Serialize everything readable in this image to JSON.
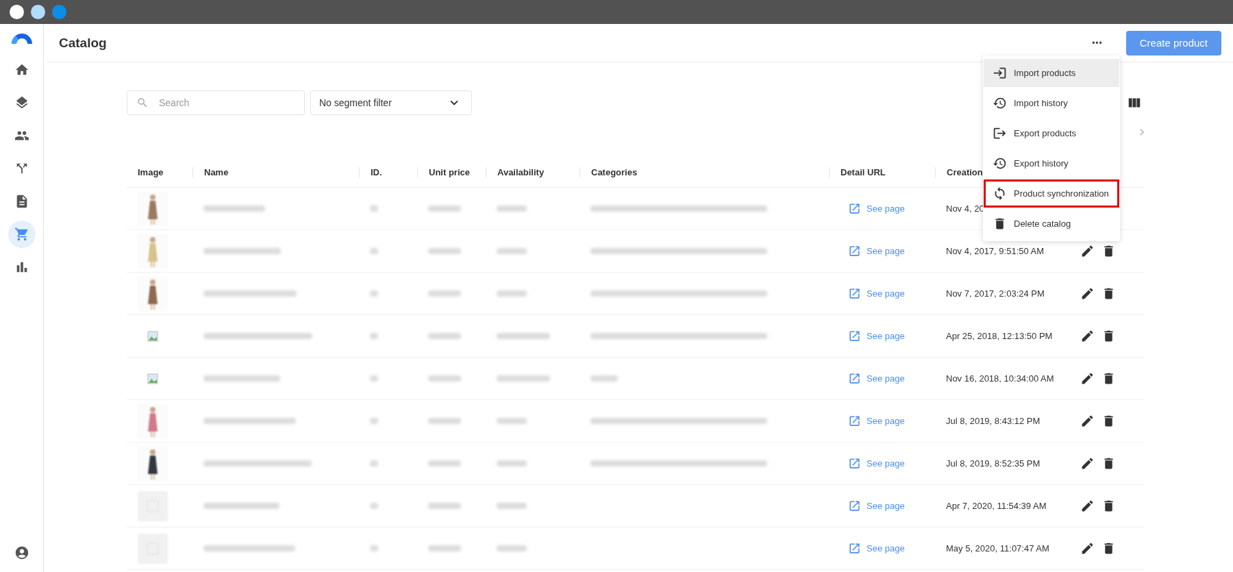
{
  "window": {
    "dots": [
      {
        "color": "#ffffff"
      },
      {
        "color": "#b3dcfb"
      },
      {
        "color": "#0a8ee8"
      }
    ]
  },
  "sidebar": {
    "items": [
      {
        "kind": "home",
        "selected": false
      },
      {
        "kind": "layers",
        "selected": false
      },
      {
        "kind": "people",
        "selected": false
      },
      {
        "kind": "branch",
        "selected": false
      },
      {
        "kind": "document",
        "selected": false
      },
      {
        "kind": "cart",
        "selected": true
      },
      {
        "kind": "chart",
        "selected": false
      }
    ]
  },
  "header": {
    "title": "Catalog",
    "more": "•••",
    "create_button": "Create product"
  },
  "toolbar": {
    "search": {
      "placeholder": "Search"
    },
    "segment_filter": {
      "value": "No segment filter"
    }
  },
  "table": {
    "columns": [
      "Image",
      "Name",
      "ID.",
      "Unit price",
      "Availability",
      "Categories",
      "Detail URL",
      "Creation"
    ],
    "rows": [
      {
        "categories": true,
        "link": "See page",
        "created": "Nov 4, 20",
        "actions": false
      },
      {
        "categories": true,
        "link": "See page",
        "created": "Nov 4, 2017, 9:51:50 AM",
        "actions": true
      },
      {
        "categories": true,
        "link": "See page",
        "created": "Nov 7, 2017, 2:03:24 PM",
        "actions": true
      },
      {
        "kind": "broken",
        "categories": true,
        "link": "See page",
        "created": "Apr 25, 2018, 12:13:50 PM",
        "actions": true
      },
      {
        "kind": "broken",
        "categories": true,
        "link": "See page",
        "created": "Nov 16, 2018, 10:34:00 AM",
        "actions": true
      },
      {
        "categories": true,
        "link": "See page",
        "created": "Jul 8, 2019, 8:43:12 PM",
        "actions": true
      },
      {
        "categories": true,
        "link": "See page",
        "created": "Jul 8, 2019, 8:52:35 PM",
        "actions": true
      },
      {
        "kind": "empty",
        "categories": false,
        "link": "See page",
        "created": "Apr 7, 2020, 11:54:39 AM",
        "actions": true
      },
      {
        "kind": "empty",
        "categories": false,
        "link": "See page",
        "created": "May 5, 2020, 11:07:47 AM",
        "actions": true
      }
    ]
  },
  "menu": {
    "items": [
      {
        "kind": "import",
        "label": "Import products",
        "hovered": true,
        "highlighted": false
      },
      {
        "kind": "history",
        "label": "Import history",
        "hovered": false,
        "highlighted": false
      },
      {
        "kind": "export",
        "label": "Export products",
        "hovered": false,
        "highlighted": false
      },
      {
        "kind": "history",
        "label": "Export history",
        "hovered": false,
        "highlighted": false
      },
      {
        "kind": "sync",
        "label": "Product synchronization",
        "hovered": false,
        "highlighted": true
      },
      {
        "kind": "delete",
        "label": "Delete catalog",
        "hovered": false,
        "highlighted": false
      }
    ]
  }
}
